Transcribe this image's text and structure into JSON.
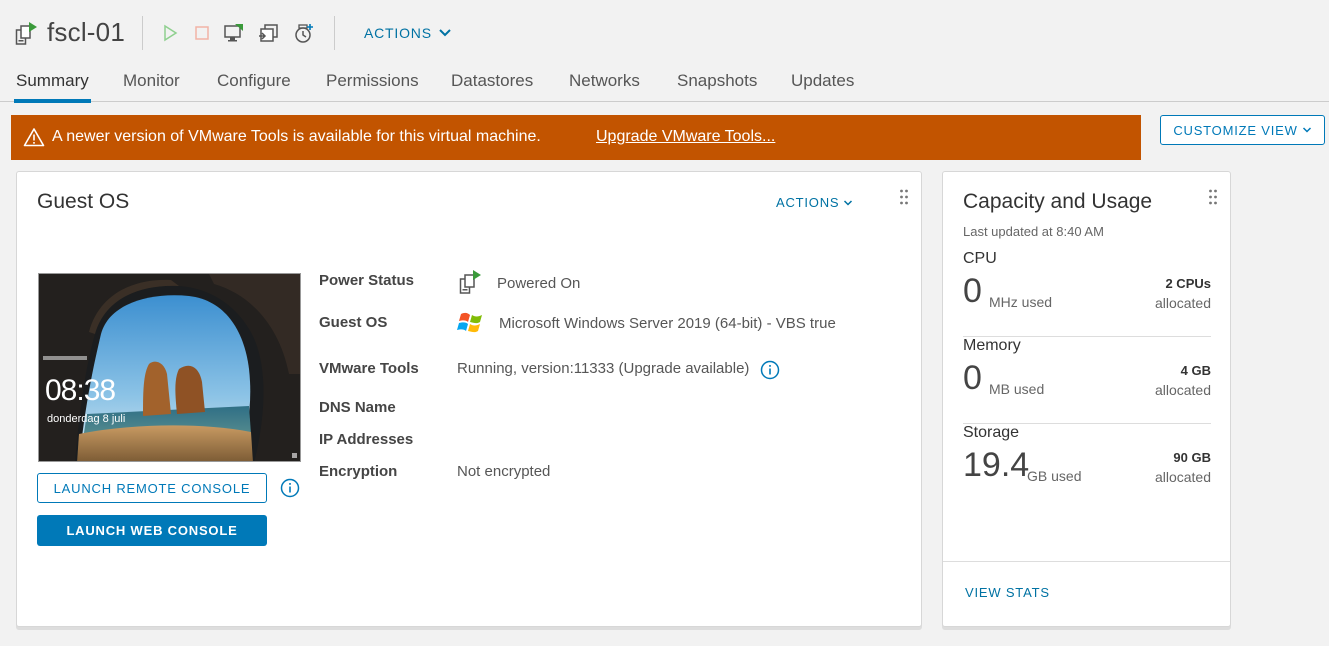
{
  "header": {
    "vm_name": "fscl-01",
    "actions_label": "ACTIONS",
    "icons": [
      "vm-icon",
      "power-on-icon",
      "power-off-icon",
      "launch-console-icon",
      "migrate-icon",
      "snapshot-icon"
    ]
  },
  "tabs": [
    {
      "label": "Summary",
      "active": true
    },
    {
      "label": "Monitor"
    },
    {
      "label": "Configure"
    },
    {
      "label": "Permissions"
    },
    {
      "label": "Datastores"
    },
    {
      "label": "Networks"
    },
    {
      "label": "Snapshots"
    },
    {
      "label": "Updates"
    }
  ],
  "banner": {
    "message": "A newer version of VMware Tools is available for this virtual machine.",
    "link": "Upgrade VMware Tools...",
    "color": "#c25400"
  },
  "customize_view": "CUSTOMIZE VIEW",
  "guest_card": {
    "title": "Guest OS",
    "actions_label": "ACTIONS",
    "thumbnail": {
      "time": "08:38",
      "date": "donderdag 8 juli"
    },
    "launch_remote": "LAUNCH REMOTE CONSOLE",
    "launch_web": "LAUNCH WEB CONSOLE",
    "properties": [
      {
        "label": "Power Status",
        "value": "Powered On"
      },
      {
        "label": "Guest OS",
        "value": "Microsoft Windows Server 2019 (64-bit) - VBS true"
      },
      {
        "label": "VMware Tools",
        "value": "Running, version:11333 (Upgrade available)"
      },
      {
        "label": "DNS Name",
        "value": ""
      },
      {
        "label": "IP Addresses",
        "value": ""
      },
      {
        "label": "Encryption",
        "value": "Not encrypted"
      }
    ]
  },
  "capacity_card": {
    "title": "Capacity and Usage",
    "last_updated": "Last updated at 8:40 AM",
    "cpu": {
      "label": "CPU",
      "value": "0",
      "unit": "MHz used",
      "alloc": "2 CPUs",
      "alloc_label": "allocated"
    },
    "memory": {
      "label": "Memory",
      "value": "0",
      "unit": "MB used",
      "alloc": "4 GB",
      "alloc_label": "allocated"
    },
    "storage": {
      "label": "Storage",
      "value": "19.4",
      "unit": "GB used",
      "alloc": "90 GB",
      "alloc_label": "allocated"
    },
    "view_stats": "VIEW STATS"
  },
  "colors": {
    "accent": "#0079b8",
    "link": "#0072a3",
    "warning": "#c25400"
  }
}
